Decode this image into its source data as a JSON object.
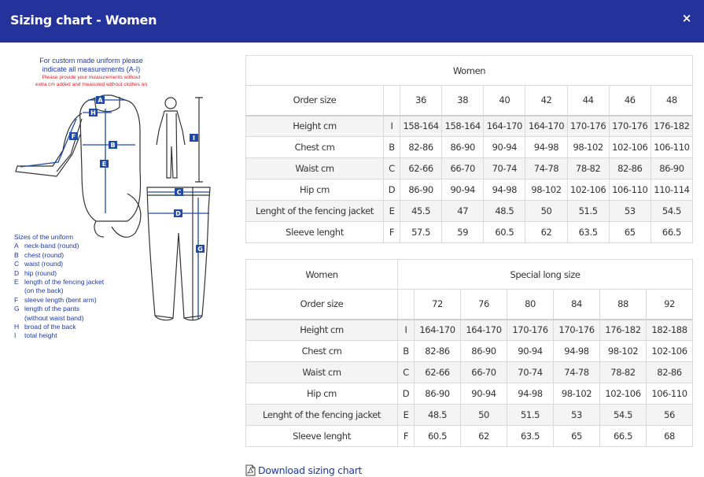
{
  "modal": {
    "title": "Sizing chart - Women",
    "close_label": "×"
  },
  "illustration": {
    "note_lines": [
      "For custom made uniform please",
      "indicate all measurements (A-I)",
      "Please provide your measurements without",
      "extra cm added and measured without clothes on"
    ],
    "markers": [
      "A",
      "H",
      "F",
      "B",
      "E",
      "I",
      "C",
      "D",
      "G"
    ],
    "legend_title": "Sizes of the uniform",
    "legend": [
      {
        "key": "A",
        "text": "neck-band (round)"
      },
      {
        "key": "B",
        "text": "chest (round)"
      },
      {
        "key": "C",
        "text": "waist (round)"
      },
      {
        "key": "D",
        "text": "hip (round)"
      },
      {
        "key": "E",
        "text": "length of the fencing jacket"
      },
      {
        "key": "",
        "text": "(on the back)"
      },
      {
        "key": "F",
        "text": "sleeve length (bent arm)"
      },
      {
        "key": "G",
        "text": "length of the pants"
      },
      {
        "key": "",
        "text": "(without waist band)"
      },
      {
        "key": "H",
        "text": "broad of the back"
      },
      {
        "key": "I",
        "text": "total height"
      }
    ]
  },
  "table1": {
    "caption": "Women",
    "order_label": "Order size",
    "sizes": [
      "36",
      "38",
      "40",
      "42",
      "44",
      "46",
      "48"
    ],
    "rows": [
      {
        "label": "Height cm",
        "code": "I",
        "values": [
          "158-164",
          "158-164",
          "164-170",
          "164-170",
          "170-176",
          "170-176",
          "176-182"
        ]
      },
      {
        "label": "Chest cm",
        "code": "B",
        "values": [
          "82-86",
          "86-90",
          "90-94",
          "94-98",
          "98-102",
          "102-106",
          "106-110"
        ]
      },
      {
        "label": "Waist cm",
        "code": "C",
        "values": [
          "62-66",
          "66-70",
          "70-74",
          "74-78",
          "78-82",
          "82-86",
          "86-90"
        ]
      },
      {
        "label": "Hip cm",
        "code": "D",
        "values": [
          "86-90",
          "90-94",
          "94-98",
          "98-102",
          "102-106",
          "106-110",
          "110-114"
        ]
      },
      {
        "label": "Lenght of the fencing jacket",
        "code": "E",
        "values": [
          "45.5",
          "47",
          "48.5",
          "50",
          "51.5",
          "53",
          "54.5"
        ]
      },
      {
        "label": "Sleeve lenght",
        "code": "F",
        "values": [
          "57.5",
          "59",
          "60.5",
          "62",
          "63.5",
          "65",
          "66.5"
        ]
      }
    ]
  },
  "table2": {
    "caption": "Women",
    "special_label": "Special long size",
    "order_label": "Order size",
    "sizes": [
      "72",
      "76",
      "80",
      "84",
      "88",
      "92"
    ],
    "rows": [
      {
        "label": "Height cm",
        "code": "I",
        "values": [
          "164-170",
          "164-170",
          "170-176",
          "170-176",
          "176-182",
          "182-188"
        ]
      },
      {
        "label": "Chest cm",
        "code": "B",
        "values": [
          "82-86",
          "86-90",
          "90-94",
          "94-98",
          "98-102",
          "102-106"
        ]
      },
      {
        "label": "Waist cm",
        "code": "C",
        "values": [
          "62-66",
          "66-70",
          "70-74",
          "74-78",
          "78-82",
          "82-86"
        ]
      },
      {
        "label": "Hip cm",
        "code": "D",
        "values": [
          "86-90",
          "90-94",
          "94-98",
          "98-102",
          "102-106",
          "106-110"
        ]
      },
      {
        "label": "Lenght of the fencing jacket",
        "code": "E",
        "values": [
          "48.5",
          "50",
          "51.5",
          "53",
          "54.5",
          "56"
        ]
      },
      {
        "label": "Sleeve lenght",
        "code": "F",
        "values": [
          "60.5",
          "62",
          "63.5",
          "65",
          "66.5",
          "68"
        ]
      }
    ]
  },
  "download": {
    "label": "Download sizing chart",
    "icon": "pdf-file-icon"
  },
  "colors": {
    "header_bg": "#24329b",
    "link": "#1f3aa8",
    "note_red": "#d9222a",
    "marker_blue": "#1f4aa8"
  }
}
